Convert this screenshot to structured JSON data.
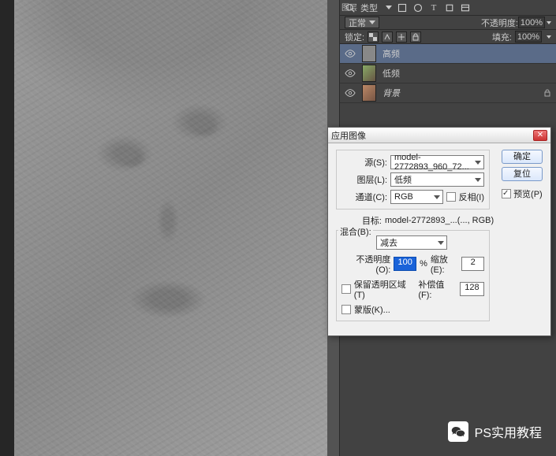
{
  "panel": {
    "title_short": "图层",
    "search_label": "类型",
    "blend_mode": "正常",
    "opacity_label": "不透明度:",
    "opacity_value": "100%",
    "lock_label": "锁定:",
    "fill_label": "填充:",
    "fill_value": "100%",
    "layers": [
      {
        "name": "高频"
      },
      {
        "name": "低频"
      },
      {
        "name": "背景"
      }
    ]
  },
  "dialog": {
    "title": "应用图像",
    "source_label": "源(S):",
    "source_value": "model-2772893_960_72...",
    "layer_label": "图层(L):",
    "layer_value": "低频",
    "channel_label": "通道(C):",
    "channel_value": "RGB",
    "invert_label": "反相(I)",
    "target_label": "目标:",
    "target_value": "model-2772893_...(..., RGB)",
    "blend_label": "混合(B):",
    "blend_value": "减去",
    "opacity_label": "不透明度(O):",
    "opacity_value": "100",
    "opacity_unit": "%",
    "scale_label": "缩放(E):",
    "scale_value": "2",
    "offset_label": "补偿值(F):",
    "offset_value": "128",
    "preserve_label": "保留透明区域(T)",
    "mask_label": "蒙版(K)...",
    "ok": "确定",
    "reset": "复位",
    "preview": "预览(P)"
  },
  "watermark": "PS实用教程"
}
